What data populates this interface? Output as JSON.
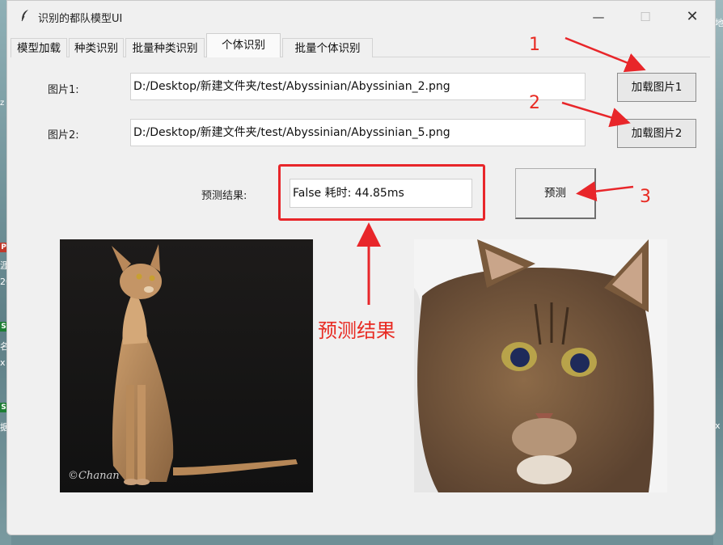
{
  "window": {
    "title": "识别的都队模型UI",
    "controls": {
      "minimize": "—",
      "maximize": "☐",
      "close": "✕"
    }
  },
  "tabs": [
    {
      "label": "模型加载"
    },
    {
      "label": "种类识别"
    },
    {
      "label": "批量种类识别"
    },
    {
      "label": "个体识别",
      "active": true
    },
    {
      "label": "批量个体识别"
    }
  ],
  "form": {
    "image1_label": "图片1:",
    "image1_path": "D:/Desktop/新建文件夹/test/Abyssinian/Abyssinian_2.png",
    "image2_label": "图片2:",
    "image2_path": "D:/Desktop/新建文件夹/test/Abyssinian/Abyssinian_5.png",
    "load1_button": "加载图片1",
    "load2_button": "加载图片2",
    "result_label": "预测结果:",
    "result_value": "False   耗时: 44.85ms",
    "predict_button": "预测"
  },
  "annotations": {
    "step1": "1",
    "step2": "2",
    "step3": "3",
    "result_caption": "预测结果",
    "color": "#e8262a"
  },
  "images": {
    "left": {
      "signature": "©Chanan"
    },
    "right": {}
  },
  "desktop_edge": {
    "left_badges": [
      "P",
      "S",
      "S"
    ],
    "left_text": [
      "z",
      "涯",
      "20",
      "名",
      "x",
      "据"
    ],
    "right_text": [
      "地",
      "x"
    ]
  }
}
